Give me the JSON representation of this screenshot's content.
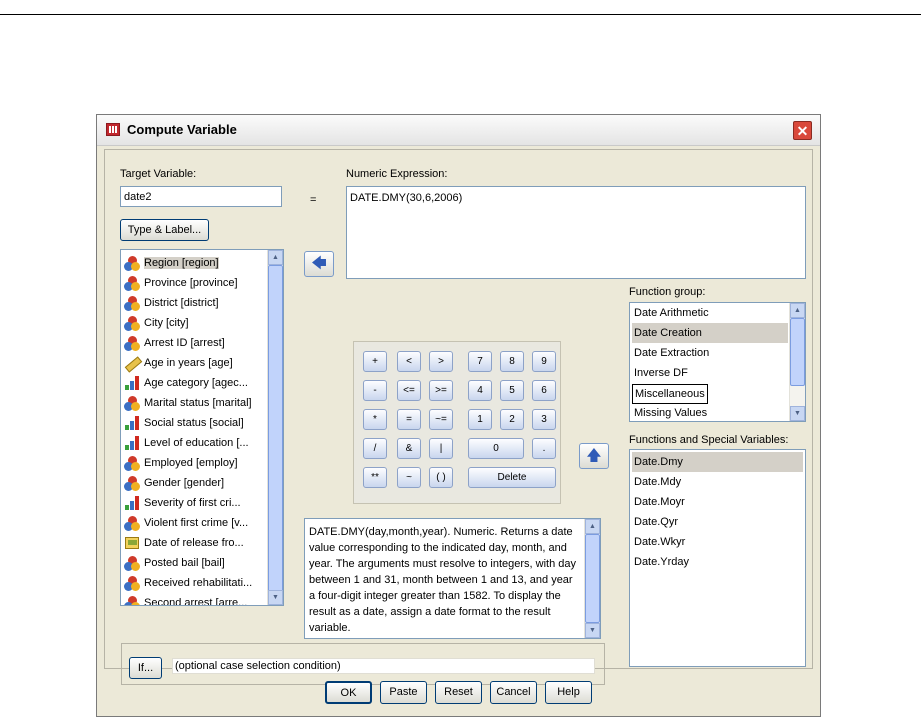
{
  "dialog": {
    "title": "Compute Variable",
    "close_glyph": "✕"
  },
  "target": {
    "label": "Target Variable:",
    "value": "date2",
    "equals": "=",
    "type_label_button": "Type & Label..."
  },
  "expression": {
    "label": "Numeric Expression:",
    "value": "DATE.DMY(30,6,2006)"
  },
  "variables": [
    {
      "label": "Region [region]",
      "icon": "nominal-icon",
      "selected": true
    },
    {
      "label": "Province [province]",
      "icon": "nominal-icon"
    },
    {
      "label": "District [district]",
      "icon": "nominal-icon"
    },
    {
      "label": "City [city]",
      "icon": "nominal-icon"
    },
    {
      "label": "Arrest ID [arrest]",
      "icon": "nominal-icon"
    },
    {
      "label": "Age in years [age]",
      "icon": "scale-icon"
    },
    {
      "label": "Age category [agec...",
      "icon": "ordinal-icon"
    },
    {
      "label": "Marital status [marital]",
      "icon": "nominal-icon"
    },
    {
      "label": "Social status [social]",
      "icon": "ordinal-icon"
    },
    {
      "label": "Level of education [...",
      "icon": "ordinal-icon"
    },
    {
      "label": "Employed [employ]",
      "icon": "nominal-icon"
    },
    {
      "label": "Gender [gender]",
      "icon": "nominal-icon"
    },
    {
      "label": "Severity of first cri...",
      "icon": "ordinal-icon"
    },
    {
      "label": "Violent first crime [v...",
      "icon": "nominal-icon"
    },
    {
      "label": "Date of release fro...",
      "icon": "date-icon"
    },
    {
      "label": "Posted bail [bail]",
      "icon": "nominal-icon"
    },
    {
      "label": "Received rehabilitati...",
      "icon": "nominal-icon"
    },
    {
      "label": "Second arrest [arre...",
      "icon": "nominal-icon"
    }
  ],
  "calculator": {
    "keys": [
      "+",
      "<",
      ">",
      "7",
      "8",
      "9",
      "-",
      "<=",
      ">=",
      "4",
      "5",
      "6",
      "*",
      "=",
      "~=",
      "1",
      "2",
      "3",
      "/",
      "&",
      "|",
      "0",
      ".",
      "**",
      "~",
      "( )",
      "Delete"
    ]
  },
  "description": "DATE.DMY(day,month,year). Numeric. Returns a date value corresponding to the indicated day, month, and year. The arguments must resolve to integers, with day between 1 and 31, month between 1 and 13, and year a four-digit integer greater than 1582. To display the result as a date, assign a date format to the result variable.",
  "function_group": {
    "label": "Function group:",
    "items": [
      "Date Arithmetic",
      "Date Creation",
      "Date Extraction",
      "Inverse DF",
      "Miscellaneous",
      "Missing Values"
    ],
    "selected": "Date Creation",
    "focused": "Miscellaneous"
  },
  "functions": {
    "label": "Functions and Special Variables:",
    "items": [
      "Date.Dmy",
      "Date.Mdy",
      "Date.Moyr",
      "Date.Qyr",
      "Date.Wkyr",
      "Date.Yrday"
    ],
    "selected": "Date.Dmy"
  },
  "if_section": {
    "button": "If...",
    "hint": "(optional case selection condition)"
  },
  "footer": {
    "ok": "OK",
    "paste": "Paste",
    "reset": "Reset",
    "cancel": "Cancel",
    "help": "Help"
  },
  "icons": {
    "move_left": "left-arrow-icon",
    "move_up": "up-arrow-icon",
    "app": "spss-data-icon"
  }
}
